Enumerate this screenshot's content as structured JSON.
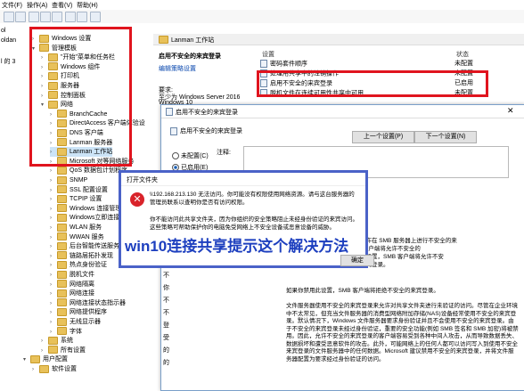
{
  "menu": {
    "items": [
      "文件(F)",
      "操作(A)",
      "查看(V)",
      "帮助(H)"
    ]
  },
  "leftstrip": {
    "labels": [
      "ol",
      "oldan",
      "l 的 3"
    ]
  },
  "tree": {
    "items": [
      {
        "label": "Windows 设置",
        "indent": 1,
        "expanded": false
      },
      {
        "label": "管理模板",
        "indent": 1,
        "expanded": true
      },
      {
        "label": "\"开始\"菜单和任务栏",
        "indent": 2,
        "expanded": false
      },
      {
        "label": "Windows 组件",
        "indent": 2,
        "expanded": false
      },
      {
        "label": "打印机",
        "indent": 2,
        "expanded": false
      },
      {
        "label": "服务器",
        "indent": 2,
        "expanded": false
      },
      {
        "label": "控制面板",
        "indent": 2,
        "expanded": false
      },
      {
        "label": "网络",
        "indent": 2,
        "expanded": true
      },
      {
        "label": "BranchCache",
        "indent": 3,
        "expanded": false
      },
      {
        "label": "DirectAccess 客户端体验设",
        "indent": 3,
        "expanded": false
      },
      {
        "label": "DNS 客户端",
        "indent": 3,
        "expanded": false
      },
      {
        "label": "Lanman 服务器",
        "indent": 3,
        "expanded": false
      },
      {
        "label": "Lanman 工作站",
        "indent": 3,
        "expanded": false,
        "selected": true
      },
      {
        "label": "Microsoft 对等网络服务",
        "indent": 3,
        "expanded": false
      },
      {
        "label": "QoS 数据包计划程序",
        "indent": 3,
        "expanded": false
      },
      {
        "label": "SNMP",
        "indent": 3,
        "expanded": false
      },
      {
        "label": "SSL 配置设置",
        "indent": 3,
        "expanded": false
      },
      {
        "label": "TCPIP 设置",
        "indent": 3,
        "expanded": false
      },
      {
        "label": "Windows 连接管理器",
        "indent": 3,
        "expanded": false
      },
      {
        "label": "Windows立即连接",
        "indent": 3,
        "expanded": false
      },
      {
        "label": "WLAN 服务",
        "indent": 3,
        "expanded": false
      },
      {
        "label": "WWAN 服务",
        "indent": 3,
        "expanded": false
      },
      {
        "label": "后台智能传送服务",
        "indent": 3,
        "expanded": false
      },
      {
        "label": "链路层拓扑发现",
        "indent": 3,
        "expanded": false
      },
      {
        "label": "热点身份验证",
        "indent": 3,
        "expanded": false
      },
      {
        "label": "脱机文件",
        "indent": 3,
        "expanded": false
      },
      {
        "label": "网络隔离",
        "indent": 3,
        "expanded": false
      },
      {
        "label": "网络连接",
        "indent": 3,
        "expanded": false
      },
      {
        "label": "网络连接状态指示器",
        "indent": 3,
        "expanded": false
      },
      {
        "label": "网络提供程序",
        "indent": 3,
        "expanded": false
      },
      {
        "label": "无线显示器",
        "indent": 3,
        "expanded": false
      },
      {
        "label": "字体",
        "indent": 3,
        "expanded": false
      },
      {
        "label": "系统",
        "indent": 2,
        "expanded": false
      },
      {
        "label": "所有设置",
        "indent": 2,
        "expanded": false
      },
      {
        "label": "用户配置",
        "indent": 0,
        "expanded": true
      },
      {
        "label": "软件设置",
        "indent": 1,
        "expanded": false
      }
    ]
  },
  "right": {
    "header": "Lanman 工作站",
    "desc_title": "启用不安全的来宾登录",
    "desc_edit_link": "编辑策略设置",
    "desc_req_label": "要求:",
    "desc_req_value": "至少为 Windows Server 2016",
    "desc_req_value2": "Windows 10",
    "col_setting": "设置",
    "col_state": "状态",
    "rows": [
      {
        "name": "密码套件顺序",
        "state": "未配置"
      },
      {
        "name": "处理用共享中的注销操作",
        "state": "未配置"
      },
      {
        "name": "启用不安全的来宾登录",
        "state": "已启用"
      },
      {
        "name": "脱机文件在连续可用性共享中可用",
        "state": "未配置"
      }
    ]
  },
  "policy_dialog": {
    "title": "启用不安全的来宾登录",
    "inner_title": "启用不安全的来宾登录",
    "prev_btn": "上一个设置(P)",
    "next_btn": "下一个设置(N)",
    "opt_unconfigured": "未配置(C)",
    "opt_enabled": "已启用(E)",
    "comment_label": "注释:",
    "left_snips": [
      "指",
      "启",
      "许",
      "在",
      "如",
      "如",
      "不",
      "不",
      "你",
      "不",
      "不",
      "登",
      "受",
      "的",
      "的"
    ],
    "help_text_1": "如果你禁用此设置，SMB 客户端将拒绝不安全的来宾登录。",
    "help_text_2": "文件服务器使用不安全的来宾登录来允许对共享文件夹进行未验证的访问。尽管在企业环境中不太常见，但充当文件服务器的消费型网络附加存储(NAS)设备经常使用不安全的来宾登录。默认情况下，Windows 文件服务器要求身份验证并且不会使用不安全的来宾登录。由于不安全的来宾登录未经过身份验证，重要的安全功能(例如 SMB 签名和 SMB 加密)将被禁用。因此，允许不安全的来宾登录的客户端容易受到各种中间人攻击，从而导致数据丢失、数据损坏和遭受恶意软件的攻击。此外，可能网络上的任何人都可以访问写入到使用不安全来宾登录的文件服务器中的任何数据。Microsoft 建议禁用不安全的来宾登录，并将文件服务器配置为要求经过身份验证的访问。",
    "side_snip_1": "如果允许在 SMB 服务器上进行不安全的来",
    "side_snip_2": "SMB 客户端将允许不安全的",
    "side_snip_3": "此策略设置，SMB 客户端将允许不安",
    "side_snip_4": "全的来宾登录。"
  },
  "error_dialog": {
    "title": "打开文件夹",
    "message_1": "\\\\192.168.213.130 无法访问。你可能没有权限使用网络资源。请与这台服务器的管理员联系以查明你是否有访问权限。",
    "message_2": "你不能访问此共享文件夹，因为你组织的安全策略阻止未经身份验证的来宾访问。这些策略可帮助保护你的电脑免受网络上不安全设备或恶意设备的威胁。",
    "ok_btn": "确定"
  },
  "overlay_caption": "win10连接共享提示这个解决方法",
  "colors": {
    "red": "#e0141e",
    "caption": "#1d3fbf",
    "dialog_border": "#4a62c8",
    "error": "#d9232a"
  }
}
